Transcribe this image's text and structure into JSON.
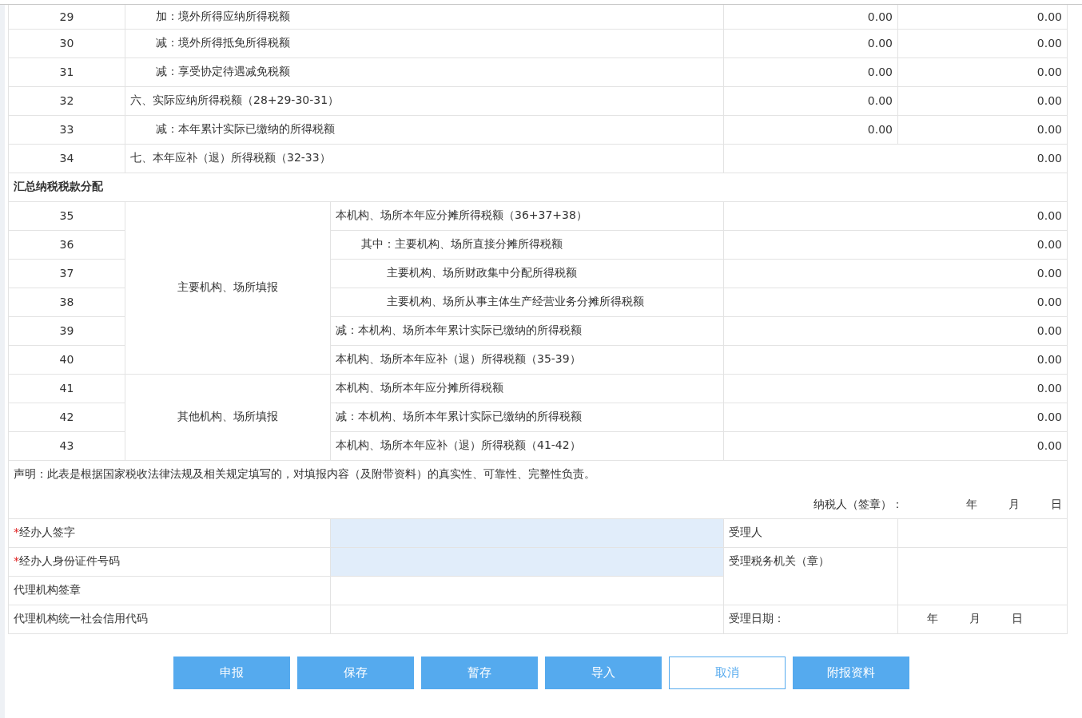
{
  "upper_rows": [
    {
      "number": "29",
      "label": "加：境外所得应纳所得税额",
      "kind": "detail",
      "values": [
        "0.00",
        "0.00"
      ]
    },
    {
      "number": "30",
      "label": "减：境外所得抵免所得税额",
      "kind": "detail",
      "values": [
        "0.00",
        "0.00"
      ]
    },
    {
      "number": "31",
      "label": "减：享受协定待遇减免税额",
      "kind": "detail",
      "values": [
        "0.00",
        "0.00"
      ]
    },
    {
      "number": "32",
      "label": "六、实际应纳所得税额（28+29-30-31）",
      "kind": "heading",
      "values": [
        "0.00",
        "0.00"
      ]
    },
    {
      "number": "33",
      "label": "减：本年累计实际已缴纳的所得税额",
      "kind": "detail",
      "values": [
        "0.00",
        "0.00"
      ]
    },
    {
      "number": "34",
      "label": "七、本年应补（退）所得税额（32-33）",
      "kind": "heading",
      "values": [
        "0.00"
      ]
    }
  ],
  "section_title": "汇总纳税税款分配",
  "groups": [
    {
      "label": "主要机构、场所填报",
      "rows": [
        {
          "number": "35",
          "label": "本机构、场所本年应分摊所得税额（36+37+38）",
          "kind": "heading",
          "value": "0.00"
        },
        {
          "number": "36",
          "label": "其中：主要机构、场所直接分摊所得税额",
          "kind": "detail",
          "value": "0.00"
        },
        {
          "number": "37",
          "label": "主要机构、场所财政集中分配所得税额",
          "kind": "subdetail",
          "value": "0.00"
        },
        {
          "number": "38",
          "label": "主要机构、场所从事主体生产经营业务分摊所得税额",
          "kind": "subdetail",
          "value": "0.00"
        },
        {
          "number": "39",
          "label": "减：本机构、场所本年累计实际已缴纳的所得税额",
          "kind": "heading",
          "value": "0.00"
        },
        {
          "number": "40",
          "label": "本机构、场所本年应补（退）所得税额（35-39）",
          "kind": "heading",
          "value": "0.00"
        }
      ]
    },
    {
      "label": "其他机构、场所填报",
      "rows": [
        {
          "number": "41",
          "label": "本机构、场所本年应分摊所得税额",
          "kind": "heading",
          "value": "0.00"
        },
        {
          "number": "42",
          "label": "减：本机构、场所本年累计实际已缴纳的所得税额",
          "kind": "heading",
          "value": "0.00"
        },
        {
          "number": "43",
          "label": "本机构、场所本年应补（退）所得税额（41-42）",
          "kind": "heading",
          "value": "0.00"
        }
      ]
    }
  ],
  "declaration": {
    "text": "声明：此表是根据国家税收法律法规及相关规定填写的，对填报内容（及附带资料）的真实性、可靠性、完整性负责。",
    "signer_label": "纳税人（签章）：",
    "date_parts": [
      "年",
      "月",
      "日"
    ]
  },
  "signature_rows": [
    {
      "required_mark": "*",
      "label": "经办人签字",
      "editable": true,
      "right_label": "受理人"
    },
    {
      "required_mark": "*",
      "label": "经办人身份证件号码",
      "editable": true,
      "right_label": "受理税务机关（章）"
    },
    {
      "label": "代理机构签章",
      "editable": false
    },
    {
      "label": "代理机构统一社会信用代码",
      "editable": false,
      "right_label": "受理日期：",
      "right_date_parts": [
        "年",
        "月",
        "日"
      ]
    }
  ],
  "buttons": [
    {
      "label": "申报",
      "kind": "primary"
    },
    {
      "label": "保存",
      "kind": "primary"
    },
    {
      "label": "暂存",
      "kind": "primary"
    },
    {
      "label": "导入",
      "kind": "primary"
    },
    {
      "label": "取消",
      "kind": "outline"
    },
    {
      "label": "附报资料",
      "kind": "primary"
    }
  ]
}
